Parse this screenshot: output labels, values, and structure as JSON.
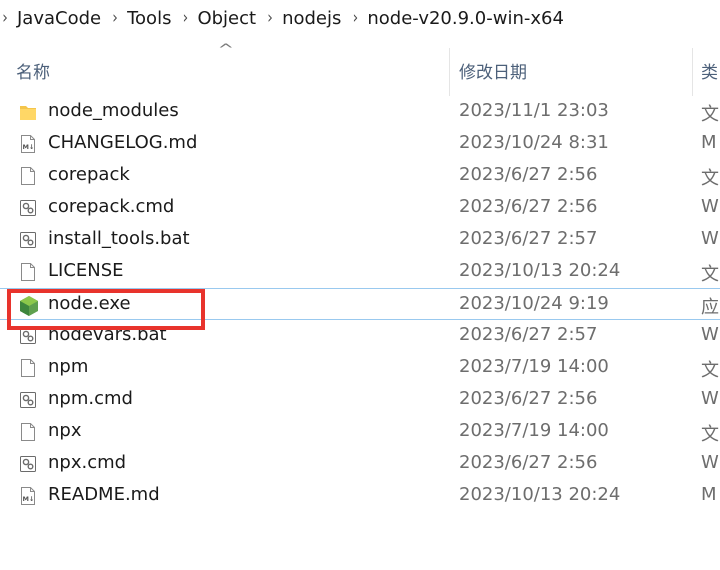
{
  "breadcrumb": [
    "JavaCode",
    "Tools",
    "Object",
    "nodejs",
    "node-v20.9.0-win-x64"
  ],
  "columns": {
    "name": "名称",
    "date": "修改日期",
    "type": "类"
  },
  "files": [
    {
      "name": "node_modules",
      "date": "2023/11/1 23:03",
      "type": "文",
      "icon": "folder-icon"
    },
    {
      "name": "CHANGELOG.md",
      "date": "2023/10/24 8:31",
      "type": "M",
      "icon": "markdown-file-icon"
    },
    {
      "name": "corepack",
      "date": "2023/6/27 2:56",
      "type": "文",
      "icon": "blank-file-icon"
    },
    {
      "name": "corepack.cmd",
      "date": "2023/6/27 2:56",
      "type": "W",
      "icon": "script-file-icon"
    },
    {
      "name": "install_tools.bat",
      "date": "2023/6/27 2:57",
      "type": "W",
      "icon": "script-file-icon"
    },
    {
      "name": "LICENSE",
      "date": "2023/10/13 20:24",
      "type": "文",
      "icon": "blank-file-icon"
    },
    {
      "name": "node.exe",
      "date": "2023/10/24 9:19",
      "type": "应",
      "icon": "nodejs-icon"
    },
    {
      "name": "nodevars.bat",
      "date": "2023/6/27 2:57",
      "type": "W",
      "icon": "script-file-icon"
    },
    {
      "name": "npm",
      "date": "2023/7/19 14:00",
      "type": "文",
      "icon": "blank-file-icon"
    },
    {
      "name": "npm.cmd",
      "date": "2023/6/27 2:56",
      "type": "W",
      "icon": "script-file-icon"
    },
    {
      "name": "npx",
      "date": "2023/7/19 14:00",
      "type": "文",
      "icon": "blank-file-icon"
    },
    {
      "name": "npx.cmd",
      "date": "2023/6/27 2:56",
      "type": "W",
      "icon": "script-file-icon"
    },
    {
      "name": "README.md",
      "date": "2023/10/13 20:24",
      "type": "M",
      "icon": "markdown-file-icon"
    }
  ],
  "colors": {
    "highlight": "#e8332c",
    "selection_border": "#99c9ef",
    "header_text": "#4c607a",
    "folder": "#f4c54b",
    "node_green": "#5fa04e"
  }
}
